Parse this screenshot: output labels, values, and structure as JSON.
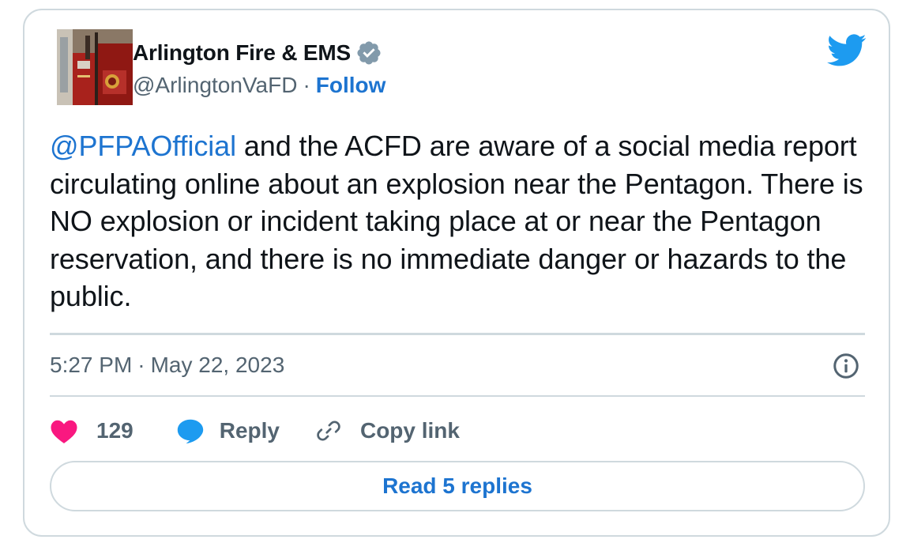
{
  "account": {
    "display_name": "Arlington Fire & EMS",
    "handle": "@ArlingtonVaFD",
    "separator": "·",
    "follow_label": "Follow",
    "verified": true
  },
  "tweet": {
    "mention": "@PFPAOfficial",
    "body": " and the ACFD are aware of a social media report circulating online about an explosion near the Pentagon. There is NO explosion or incident taking place at or near the Pentagon reservation, and there is no immediate danger or hazards to the public.",
    "time": "5:27 PM",
    "separator": "·",
    "date": "May 22, 2023"
  },
  "actions": {
    "like_count": "129",
    "reply_label": "Reply",
    "copy_link_label": "Copy link",
    "read_replies_label": "Read 5 replies"
  },
  "colors": {
    "link_blue": "#1d74d0",
    "twitter_blue": "#1d9bf0",
    "like_pink": "#f91880",
    "border_gray": "#cfd9de",
    "secondary_text": "#536471"
  },
  "icons": [
    "verified-badge-icon",
    "twitter-bird-icon",
    "info-icon",
    "heart-icon",
    "reply-bubble-icon",
    "link-icon"
  ]
}
